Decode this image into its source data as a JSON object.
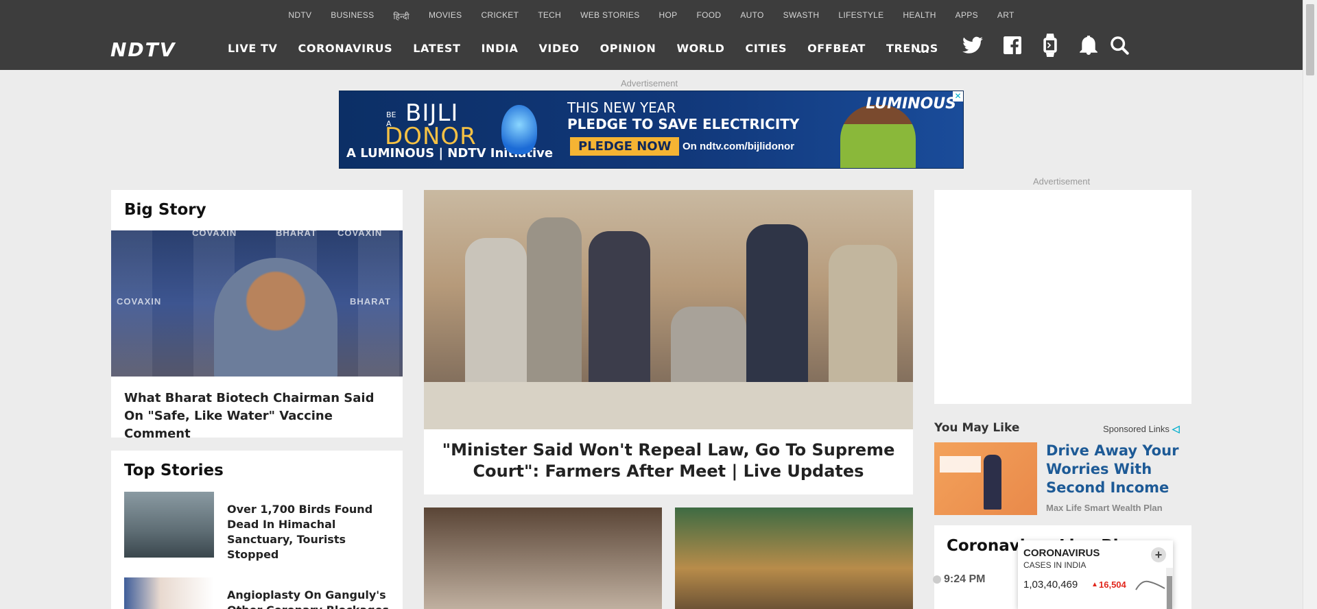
{
  "header": {
    "subnav": [
      "NDTV",
      "BUSINESS",
      "हिन्दी",
      "MOVIES",
      "CRICKET",
      "TECH",
      "WEB STORIES",
      "HOP",
      "FOOD",
      "AUTO",
      "SWASTH",
      "LIFESTYLE",
      "HEALTH",
      "APPS",
      "ART"
    ],
    "logo": "NDTV",
    "mainnav": [
      "LIVE TV",
      "CORONAVIRUS",
      "LATEST",
      "INDIA",
      "VIDEO",
      "OPINION",
      "WORLD",
      "CITIES",
      "OFFBEAT",
      "TRENDS"
    ],
    "more": "...",
    "icons": [
      "twitter-icon",
      "facebook-icon",
      "smartwatch-icon",
      "notification-bell-icon",
      "search-icon"
    ]
  },
  "ads": {
    "top_label": "Advertisement",
    "side_label": "Advertisement",
    "banner": {
      "be_a": "BE A",
      "bijli": "BIJLI",
      "donor": "DONOR",
      "initiative": "A LUMINOUS | NDTV Initiative",
      "line1": "THIS NEW YEAR",
      "line2": "PLEDGE TO SAVE ELECTRICITY",
      "button": "PLEDGE NOW",
      "url": "On ndtv.com/bijlidonor",
      "brand": "LUMINOUS",
      "close": "✕"
    }
  },
  "big_story": {
    "title": "Big Story",
    "headline": "What Bharat Biotech Chairman Said On \"Safe, Like Water\" Vaccine Comment",
    "watermarks": [
      "COVAXIN",
      "BHARAT",
      "COVAXIN",
      "BHARAT",
      "COVAXIN"
    ]
  },
  "lead_story": {
    "headline": "\"Minister Said Won't Repeal Law, Go To Supreme Court\": Farmers After Meet | Live Updates"
  },
  "top_stories": {
    "title": "Top Stories",
    "items": [
      {
        "headline": "Over 1,700 Birds Found Dead In Himachal Sanctuary, Tourists Stopped"
      },
      {
        "headline": "Angioplasty On Ganguly's Other Coronary Blockages To"
      }
    ]
  },
  "you_may_like": {
    "title": "You May Like",
    "sponsored": "Sponsored Links",
    "headline": "Drive Away Your Worries With Second Income",
    "source": "Max Life Smart Wealth Plan"
  },
  "coronavirus_blog": {
    "title": "Coronavirus Live Blog",
    "time": "9:24 PM"
  },
  "corona_widget": {
    "title": "CORONAVIRUS",
    "subtitle": "CASES IN INDIA",
    "cases": "1,03,40,469",
    "delta": "16,504",
    "plus": "+"
  },
  "colors": {
    "header_bg": "#3d3d3d",
    "accent_red": "#e1261c",
    "link_blue": "#1d5a96"
  }
}
